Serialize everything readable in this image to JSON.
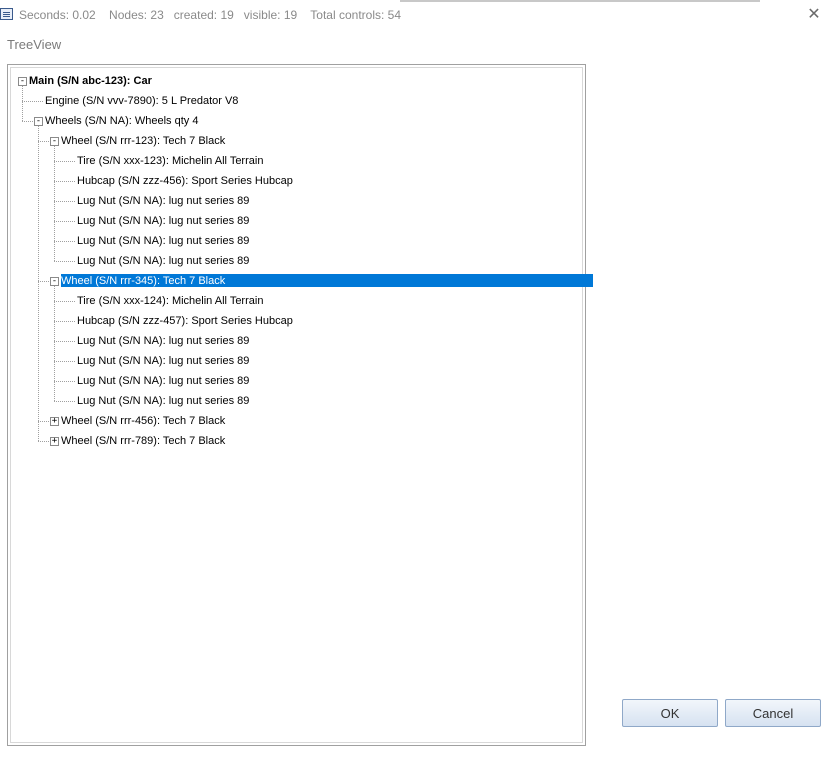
{
  "titlebar": {
    "status": "Seconds: 0.02    Nodes: 23   created: 19   visible: 19    Total controls: 54",
    "close_label": "✕"
  },
  "section_label": "TreeView",
  "tree": {
    "expanded_symbol": "-",
    "collapsed_symbol": "+",
    "nodes": [
      {
        "label": "Main (S/N abc-123): Car",
        "level": 0,
        "expander": "-"
      },
      {
        "label": "Engine (S/N vvv-7890): 5 L Predator V8",
        "level": 1,
        "expander": ""
      },
      {
        "label": "Wheels (S/N NA): Wheels qty 4",
        "level": 1,
        "expander": "-"
      },
      {
        "label": "Wheel (S/N rrr-123): Tech 7 Black",
        "level": 2,
        "expander": "-"
      },
      {
        "label": "Tire (S/N xxx-123): Michelin All Terrain",
        "level": 3,
        "expander": ""
      },
      {
        "label": "Hubcap (S/N zzz-456): Sport Series Hubcap",
        "level": 3,
        "expander": ""
      },
      {
        "label": "Lug Nut (S/N NA): lug nut series 89",
        "level": 3,
        "expander": ""
      },
      {
        "label": "Lug Nut (S/N NA): lug nut series 89",
        "level": 3,
        "expander": ""
      },
      {
        "label": "Lug Nut (S/N NA): lug nut series 89",
        "level": 3,
        "expander": ""
      },
      {
        "label": "Lug Nut (S/N NA): lug nut series 89",
        "level": 3,
        "expander": ""
      },
      {
        "label": "Wheel (S/N rrr-345): Tech 7 Black",
        "level": 2,
        "expander": "-",
        "selected": true
      },
      {
        "label": "Tire (S/N xxx-124): Michelin All Terrain",
        "level": 3,
        "expander": ""
      },
      {
        "label": "Hubcap (S/N zzz-457): Sport Series Hubcap",
        "level": 3,
        "expander": ""
      },
      {
        "label": "Lug Nut (S/N NA): lug nut series 89",
        "level": 3,
        "expander": ""
      },
      {
        "label": "Lug Nut (S/N NA): lug nut series 89",
        "level": 3,
        "expander": ""
      },
      {
        "label": "Lug Nut (S/N NA): lug nut series 89",
        "level": 3,
        "expander": ""
      },
      {
        "label": "Lug Nut (S/N NA): lug nut series 89",
        "level": 3,
        "expander": ""
      },
      {
        "label": "Wheel (S/N rrr-456): Tech 7 Black",
        "level": 2,
        "expander": "+"
      },
      {
        "label": "Wheel (S/N rrr-789): Tech 7 Black",
        "level": 2,
        "expander": "+"
      }
    ]
  },
  "buttons": {
    "ok": "OK",
    "cancel": "Cancel"
  },
  "colors": {
    "selection": "#0078d7",
    "selected_text": "#ffffff",
    "status_text": "#8a8a8a"
  }
}
